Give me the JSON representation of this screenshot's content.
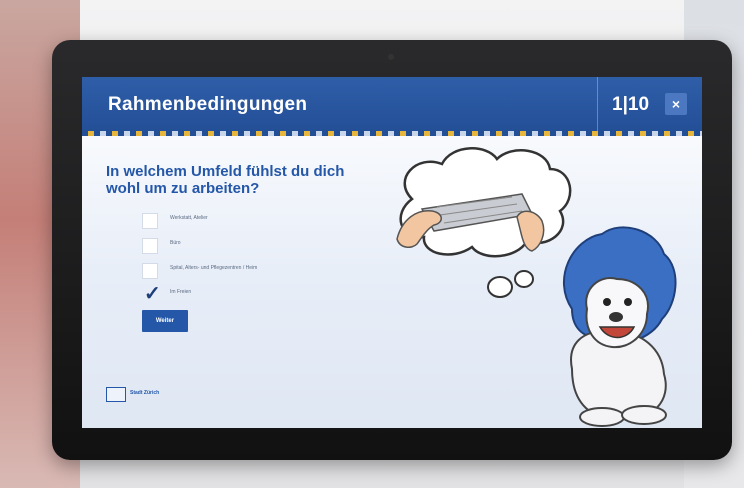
{
  "header": {
    "title": "Rahmenbedingungen",
    "page_indicator": "1|10",
    "close_label": "×"
  },
  "question": "In welchem Umfeld fühlst du dich wohl um zu arbeiten?",
  "options": [
    {
      "label": "Werkstatt, Atelier",
      "checked": false
    },
    {
      "label": "Büro",
      "checked": false
    },
    {
      "label": "Spital, Alters- und Pflegezentren / Heim",
      "checked": false
    },
    {
      "label": "Im Freien",
      "checked": true
    }
  ],
  "next_button": "Weiter",
  "footer": {
    "logo_text": "Stadt Zürich"
  },
  "colors": {
    "primary": "#2457a8",
    "header": "#2f5ea8",
    "accent": "#e8b63a"
  }
}
